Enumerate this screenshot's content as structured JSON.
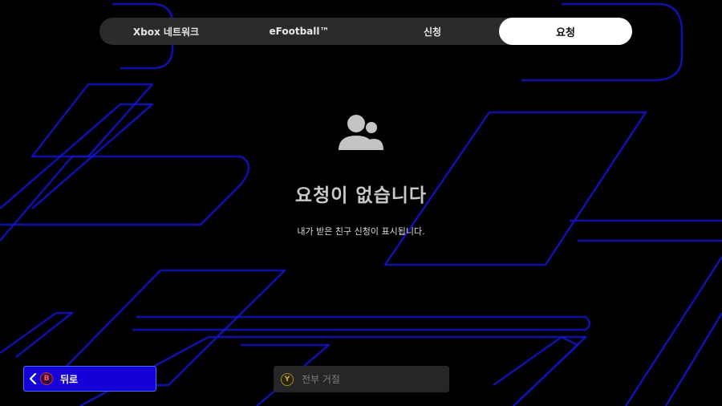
{
  "tabs": [
    {
      "label": "Xbox 네트워크",
      "active": false
    },
    {
      "label": "eFootball™",
      "active": false
    },
    {
      "label": "신청",
      "active": false
    },
    {
      "label": "요청",
      "active": true
    }
  ],
  "empty_state": {
    "icon": "users-icon",
    "title": "요청이 없습니다",
    "description": "내가 받은 친구 신청이 표시됩니다."
  },
  "footer": {
    "back": {
      "badge": "B",
      "label": "뒤로",
      "icon": "chevron-left-icon"
    },
    "reject_all": {
      "badge": "Y",
      "label": "전부 거절"
    }
  },
  "colors": {
    "background": "#000000",
    "accent_line": "#1a1aff",
    "back_button": "#1500d8",
    "tab_bar": "#2b2b2e",
    "active_tab": "#ffffff"
  }
}
